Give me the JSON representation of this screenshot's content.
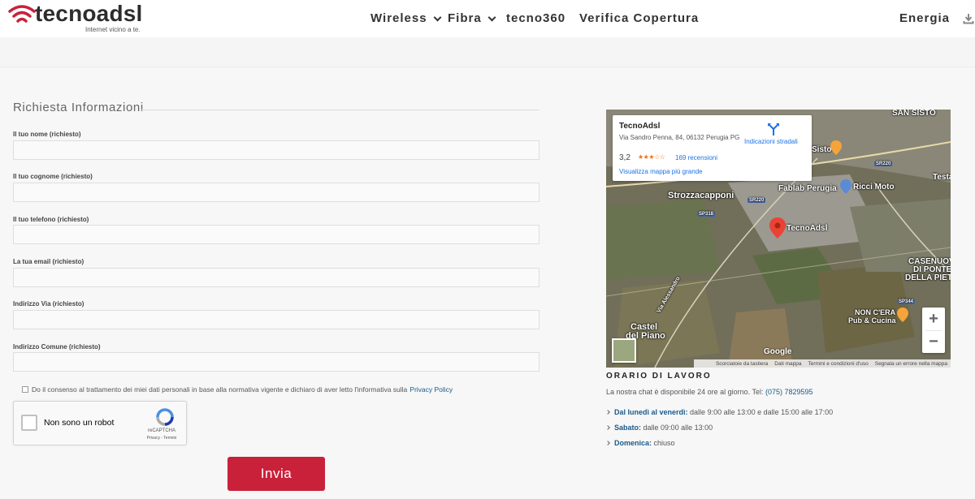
{
  "brand": {
    "name": "tecnoadsl",
    "tagline": "Internet vicino a te."
  },
  "nav": {
    "items": [
      {
        "label": "Wireless",
        "dropdown": true
      },
      {
        "label": "Fibra",
        "dropdown": true
      },
      {
        "label": "tecno360",
        "dropdown": false
      },
      {
        "label": "Verifica Copertura",
        "dropdown": false
      },
      {
        "label": "Energia",
        "dropdown": false
      }
    ],
    "download_icon": "download-icon"
  },
  "form": {
    "title": "Richiesta Informazioni",
    "fields": [
      {
        "label": "Il tuo nome (richiesto)",
        "value": "",
        "placeholder": ""
      },
      {
        "label": "Il tuo cognome (richiesto)",
        "value": "",
        "placeholder": ""
      },
      {
        "label": "Il tuo telefono (richiesto)",
        "value": "",
        "placeholder": ""
      },
      {
        "label": "La tua email (richiesto)",
        "value": "",
        "placeholder": ""
      },
      {
        "label": "Indirizzo Via (richiesto)",
        "value": "",
        "placeholder": ""
      },
      {
        "label": "Indirizzo Comune (richiesto)",
        "value": "",
        "placeholder": ""
      }
    ],
    "consent": {
      "text": "Do il consenso al trattamento dei miei dati personali in base alla normativa vigente e dichiaro di aver letto l'informativa sulla",
      "link": "Privacy Policy"
    },
    "captcha": {
      "label": "Non sono un robot",
      "brand": "reCAPTCHA",
      "links": "Privacy - Termini"
    },
    "submit_label": "Invia",
    "submit_color": "#c9213a"
  },
  "map": {
    "place_name": "TecnoAdsl",
    "address": "Via Sandro Penna, 84, 06132 Perugia PG",
    "rating": "3,2",
    "stars": 3.2,
    "reviews": "169 recensioni",
    "larger_map_link": "Visualizza mappa più grande",
    "directions_label": "Indicazioni stradali",
    "labels": {
      "san_sisto": "SAN SISTO",
      "sisto": "Sisto",
      "testa": "Testa",
      "strozzacapponi": "Strozzacapponi",
      "fablab": "Fablab Perugia",
      "ricci_moto": "Ricci Moto",
      "tecnoadsl": "TecnoAdsl",
      "casenuove_1": "CASENUOVE",
      "casenuove_2": "DI PONTE",
      "casenuove_3": "DELLA PIETRA",
      "non_cera_1": "NON C'ERA",
      "non_cera_2": "Pub & Cucina",
      "castel_1": "Castel",
      "castel_2": "del Piano",
      "via_alessandro": "Via Alessandro",
      "sr220_a": "SR220",
      "sr220_b": "SR220",
      "sp318": "SP318",
      "sp344": "SP344",
      "google": "Google"
    },
    "zoom_in": "+",
    "zoom_out": "−",
    "footer": [
      "Scorciatoie da tastiera",
      "Dati mappa",
      "Termini e condizioni d'uso",
      "Segnala un errore nella mappa"
    ]
  },
  "hours": {
    "title": "ORARIO DI LAVORO",
    "intro": "La nostra chat è disponibile 24 ore al giorno. Tel:",
    "phone": "(075) 7829595",
    "items": [
      {
        "day": "Dal lunedì al venerdì:",
        "time": "dalle 9:00 alle 13:00 e dalle 15:00 alle 17:00"
      },
      {
        "day": "Sabato:",
        "time": "dalle 09:00 alle 13:00"
      },
      {
        "day": "Domenica:",
        "time": "chiuso"
      }
    ]
  }
}
